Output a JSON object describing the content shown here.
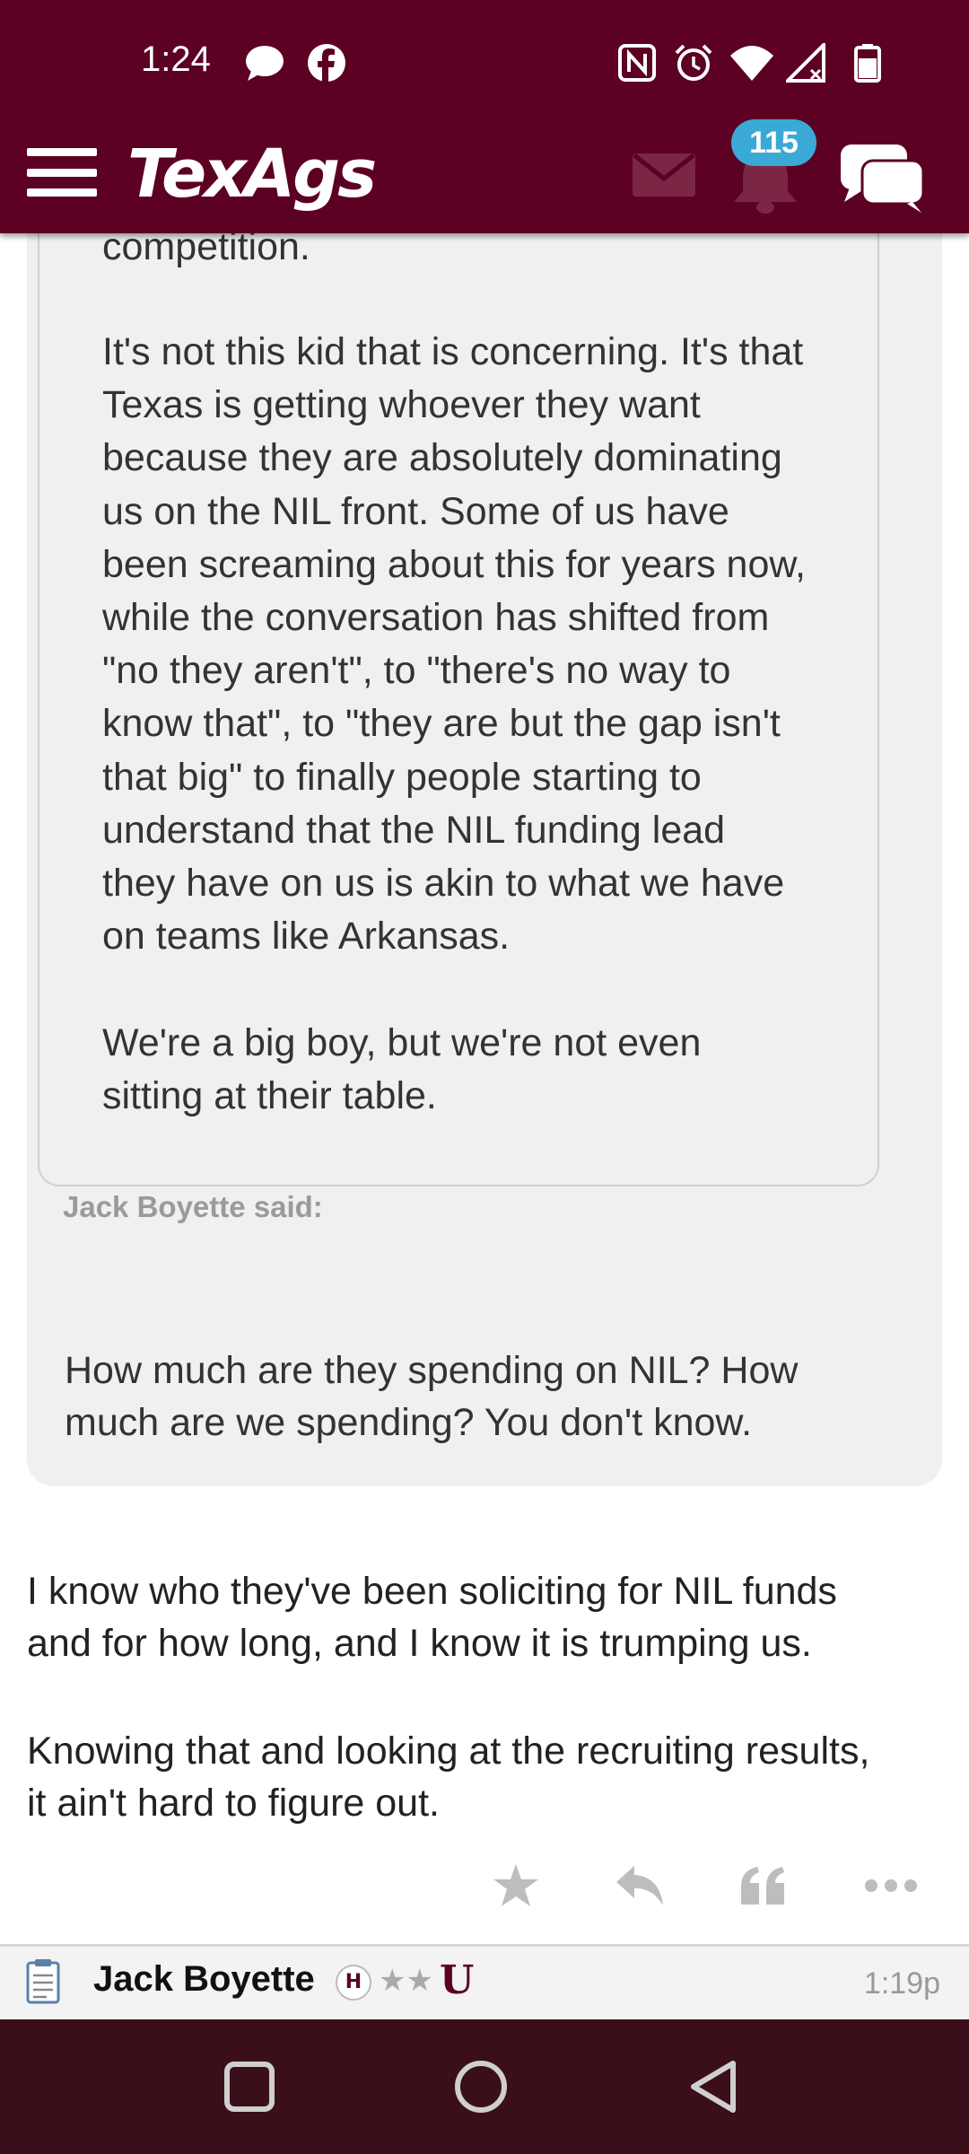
{
  "status_bar": {
    "time": "1:24",
    "left_icons": [
      "messenger-icon",
      "facebook-icon"
    ],
    "right_icons": [
      "nfc-icon",
      "alarm-icon",
      "wifi-icon",
      "signal-icon",
      "battery-icon"
    ]
  },
  "header": {
    "logo": "TexAgs",
    "notification_count": "115",
    "brand_color": "#5c0024",
    "badge_color": "#3aa9d6"
  },
  "quote": {
    "top_partial": "competition.",
    "paragraph1": [
      "It's not this kid that is concerning. It's that",
      "Texas is getting whoever they want",
      "because they are absolutely dominating",
      "us on the NIL front. Some of us have",
      "been screaming about this for years now,",
      "while the conversation has shifted from",
      "\"no they aren't\", to \"there's no way to",
      "know that\", to \"they are but the gap isn't",
      "that big\" to finally people starting to",
      "understand that the NIL funding lead",
      "they have on us is akin to what we have",
      "on teams like Arkansas."
    ],
    "paragraph2": [
      "We're a big boy, but we're not even",
      "sitting at their table."
    ],
    "attribution": "Jack Boyette said:",
    "reply": [
      "How much are they spending on NIL? How",
      "much are we spending? You don't know."
    ]
  },
  "post": {
    "paragraph1": [
      "I know who they've been soliciting for NIL funds",
      "and for how long, and I know it is trumping us."
    ],
    "paragraph2": [
      "Knowing that and looking at the recruiting results,",
      "it ain't hard to figure out."
    ]
  },
  "actions": [
    "star-icon",
    "reply-icon",
    "quote-icon",
    "more-icon"
  ],
  "next_post": {
    "username": "Jack Boyette",
    "badge_h": "H",
    "stars": "★★",
    "mark": "U",
    "time": "1:19p"
  }
}
